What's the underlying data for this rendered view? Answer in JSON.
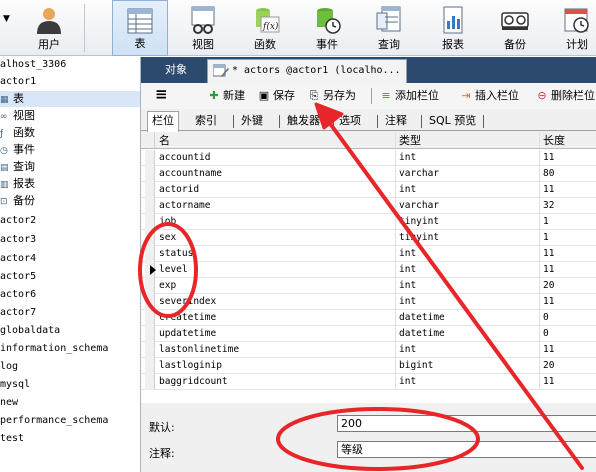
{
  "toolbar": {
    "items": [
      {
        "label": "用户",
        "icon": "user-icon"
      },
      {
        "label": "表",
        "icon": "table-icon",
        "active": true
      },
      {
        "label": "视图",
        "icon": "view-icon"
      },
      {
        "label": "函数",
        "icon": "function-icon",
        "glyph": "f(x)"
      },
      {
        "label": "事件",
        "icon": "event-icon"
      },
      {
        "label": "查询",
        "icon": "query-icon"
      },
      {
        "label": "报表",
        "icon": "report-icon"
      },
      {
        "label": "备份",
        "icon": "backup-icon"
      },
      {
        "label": "计划",
        "icon": "schedule-icon"
      }
    ]
  },
  "tree": {
    "items": [
      {
        "label": "alhost_3306",
        "icon": ""
      },
      {
        "label": "actor1",
        "icon": ""
      },
      {
        "label": "表",
        "icon": "table-icon",
        "selected": true
      },
      {
        "label": "视图",
        "icon": "view-icon"
      },
      {
        "label": "函数",
        "icon": "function-icon"
      },
      {
        "label": "事件",
        "icon": "event-icon"
      },
      {
        "label": "查询",
        "icon": "query-icon"
      },
      {
        "label": "报表",
        "icon": "report-icon"
      },
      {
        "label": "备份",
        "icon": "backup-icon"
      },
      {
        "label": "actor2",
        "icon": ""
      },
      {
        "label": "actor3",
        "icon": ""
      },
      {
        "label": "actor4",
        "icon": ""
      },
      {
        "label": "actor5",
        "icon": ""
      },
      {
        "label": "actor6",
        "icon": ""
      },
      {
        "label": "actor7",
        "icon": ""
      },
      {
        "label": "globaldata",
        "icon": ""
      },
      {
        "label": "information_schema",
        "icon": ""
      },
      {
        "label": "log",
        "icon": ""
      },
      {
        "label": "mysql",
        "icon": ""
      },
      {
        "label": "new",
        "icon": ""
      },
      {
        "label": "performance_schema",
        "icon": ""
      },
      {
        "label": "test",
        "icon": ""
      }
    ]
  },
  "tabs": {
    "object_label": "对象",
    "document_title": "* actors @actor1 (localho..."
  },
  "actions": {
    "menu_icon": "≡",
    "new_label": "新建",
    "save_label": "保存",
    "save_as_label": "另存为",
    "add_column_label": "添加栏位",
    "insert_column_label": "插入栏位",
    "delete_column_label": "删除栏位"
  },
  "subtabs": [
    "栏位",
    "索引",
    "外键",
    "触发器",
    "选项",
    "注释",
    "SQL 预览"
  ],
  "grid": {
    "columns": [
      "名",
      "类型",
      "长度"
    ],
    "rows": [
      {
        "name": "accountid",
        "type": "int",
        "length": "11"
      },
      {
        "name": "accountname",
        "type": "varchar",
        "length": "80"
      },
      {
        "name": "actorid",
        "type": "int",
        "length": "11"
      },
      {
        "name": "actorname",
        "type": "varchar",
        "length": "32"
      },
      {
        "name": "job",
        "type": "tinyint",
        "length": "1"
      },
      {
        "name": "sex",
        "type": "tinyint",
        "length": "1"
      },
      {
        "name": "status",
        "type": "int",
        "length": "11"
      },
      {
        "name": "level",
        "type": "int",
        "length": "11",
        "current": true
      },
      {
        "name": "exp",
        "type": "int",
        "length": "20"
      },
      {
        "name": "severindex",
        "type": "int",
        "length": "11"
      },
      {
        "name": "createtime",
        "type": "datetime",
        "length": "0"
      },
      {
        "name": "updatetime",
        "type": "datetime",
        "length": "0"
      },
      {
        "name": "lastonlinetime",
        "type": "int",
        "length": "11"
      },
      {
        "name": "lastloginip",
        "type": "bigint",
        "length": "20"
      },
      {
        "name": "baggridcount",
        "type": "int",
        "length": "11"
      }
    ]
  },
  "properties": {
    "default_label": "默认:",
    "default_value": "200",
    "comment_label": "注释:",
    "comment_value": "等级"
  },
  "colors": {
    "annotation_red": "#e8262a",
    "tab_bar": "#2c4a6d",
    "selection": "#d8e6f7"
  }
}
